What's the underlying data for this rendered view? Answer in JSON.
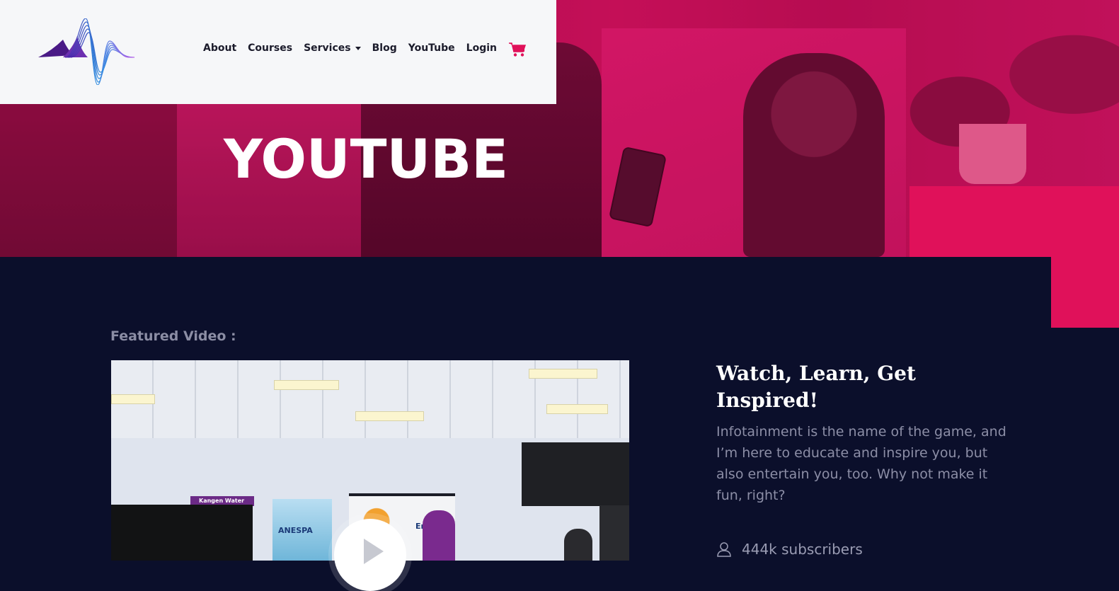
{
  "header": {
    "nav": [
      {
        "label": "About"
      },
      {
        "label": "Courses"
      },
      {
        "label": "Services",
        "has_dropdown": true
      },
      {
        "label": "Blog"
      },
      {
        "label": "YouTube"
      },
      {
        "label": "Login"
      }
    ],
    "cart_icon": "shopping-cart-icon",
    "logo_icon": "soundwave-logo"
  },
  "hero": {
    "title": "YOUTUBE"
  },
  "featured": {
    "label": "Featured Video :",
    "play_icon": "play-icon",
    "banner_left_header": "Kangen Water",
    "banner_left_title": "ANESPA",
    "banner_right_title": "En"
  },
  "side": {
    "title": "Watch, Learn, Get Inspired!",
    "description": "Infotainment is the name of the game, and I’m here to educate and inspire you, but also entertain you, too. Why not make it fun, right?",
    "subscribers": "444k subscribers",
    "subscribers_icon": "user-icon"
  },
  "colors": {
    "accent": "#e0115a",
    "background": "#0b0f2b",
    "header_bg": "#f6f7f9",
    "muted_text": "#8c8ea6"
  }
}
